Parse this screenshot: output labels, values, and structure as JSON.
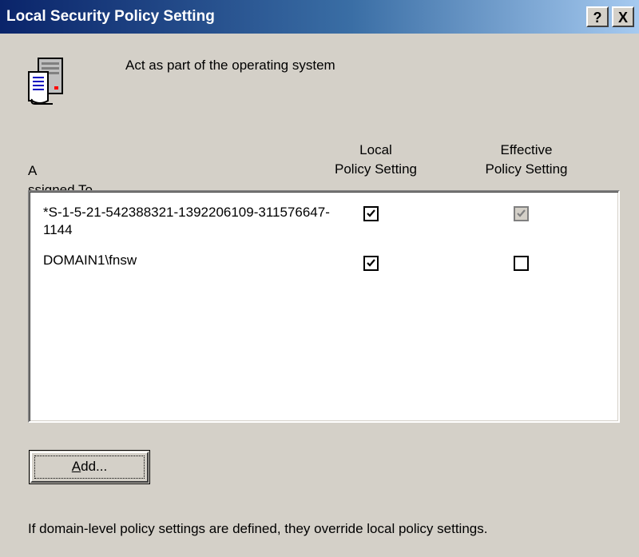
{
  "window": {
    "title": "Local Security Policy Setting",
    "help_label": "?",
    "close_label": "X"
  },
  "policy": {
    "icon": "policy-server-icon",
    "name": "Act as part of the operating system"
  },
  "columns": {
    "assigned_to": {
      "prefix": "A",
      "accel": "s",
      "rest": "signed To"
    },
    "local": [
      "Local",
      "Policy Setting"
    ],
    "effective": [
      "Effective",
      "Policy Setting"
    ]
  },
  "rows": [
    {
      "name": "*S-1-5-21-542388321-1392206109-311576647-1144",
      "local_checked": true,
      "effective_checked": true,
      "effective_disabled": true
    },
    {
      "name": "DOMAIN1\\fnsw",
      "local_checked": true,
      "effective_checked": false,
      "effective_disabled": false
    }
  ],
  "add_button": {
    "accel": "A",
    "rest": "dd..."
  },
  "footer_note": "If domain-level policy settings are defined, they override local policy settings.",
  "colors": {
    "title_gradient_start": "#0a246a",
    "title_gradient_end": "#a6caf0",
    "dialog_face": "#d4d0c8"
  }
}
